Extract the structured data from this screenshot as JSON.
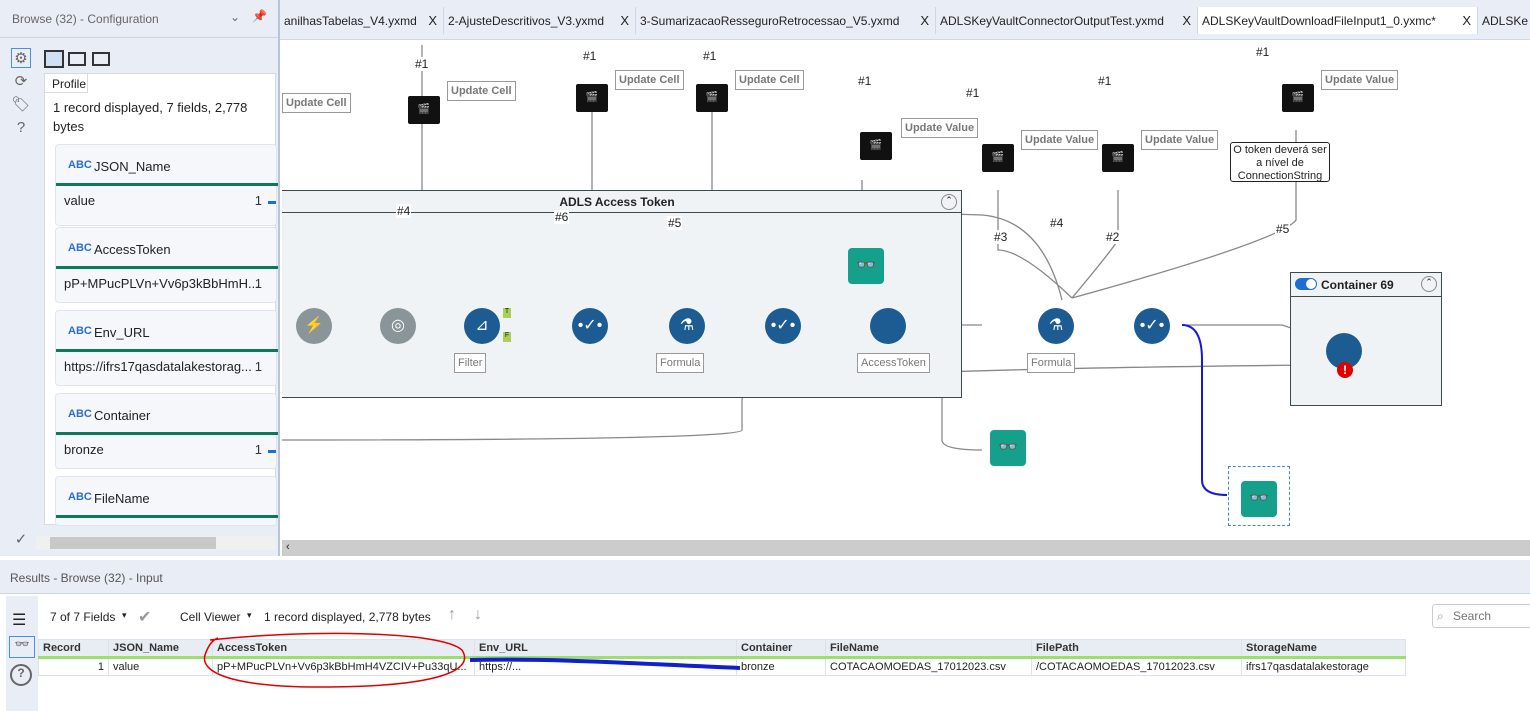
{
  "config_panel": {
    "title": "Browse (32) - Configuration",
    "profile_tab": "Profile",
    "summary": "1 record displayed, 7 fields, 2,778 bytes",
    "fields": [
      {
        "name": "JSON_Name",
        "value": "value",
        "count": "1"
      },
      {
        "name": "AccessToken",
        "value": "pP+MPucPLVn+Vv6p3kBbHmH...",
        "count": "1"
      },
      {
        "name": "Env_URL",
        "value": "https://ifrs17qasdatalakestorag...",
        "count": "1"
      },
      {
        "name": "Container",
        "value": "bronze",
        "count": "1"
      },
      {
        "name": "FileName"
      }
    ]
  },
  "tabs": [
    {
      "label": "anilhasTabelas_V4.yxmd"
    },
    {
      "label": "2-AjusteDescritivos_V3.yxmd"
    },
    {
      "label": "3-SumarizacaoResseguroRetrocessao_V5.yxmd"
    },
    {
      "label": "ADLSKeyVaultConnectorOutputTest.yxmd"
    },
    {
      "label": "ADLSKeyVaultDownloadFileInput1_0.yxmc*",
      "active": true
    },
    {
      "label": "ADLSKe"
    }
  ],
  "tab_close": "X",
  "canvas": {
    "container_main": "ADLS Access Token",
    "container_69": "Container 69",
    "update_cell": "Update Cell",
    "update_value": "Update Value",
    "hash1": "#1",
    "hash2": "#2",
    "hash3": "#3",
    "hash4": "#4",
    "hash5": "#5",
    "hash6": "#6",
    "filter_label": "Filter",
    "formula_label": "Formula",
    "accesstoken_label": "AccessToken",
    "formula2_label": "Formula",
    "anchor_t": "T",
    "anchor_f": "F",
    "comment": "O token deverá ser a nível de ConnectionString"
  },
  "results": {
    "title": "Results - Browse (32) - Input",
    "fields_selector": "7 of 7 Fields",
    "cell_viewer": "Cell Viewer",
    "summary": "1 record displayed, 2,778 bytes",
    "search_placeholder": "Search",
    "columns": [
      "Record",
      "JSON_Name",
      "AccessToken",
      "Env_URL",
      "Container",
      "FileName",
      "FilePath",
      "StorageName"
    ],
    "rows": [
      [
        "1",
        "value",
        "pP+MPucPLVn+Vv6p3kBbHmH4VZCIV+Pu33qU...",
        "https://...",
        "bronze",
        "COTACAOMOEDAS_17012023.csv",
        "/COTACAOMOEDAS_17012023.csv",
        "ifrs17qasdatalakestorage"
      ]
    ]
  },
  "colors": {
    "tool_blue": "#1c5c93",
    "browse_teal": "#14a08a",
    "anchor_green": "#a9cf5a",
    "annotation_red": "#e00000",
    "scribble_blue": "#1020d0"
  }
}
